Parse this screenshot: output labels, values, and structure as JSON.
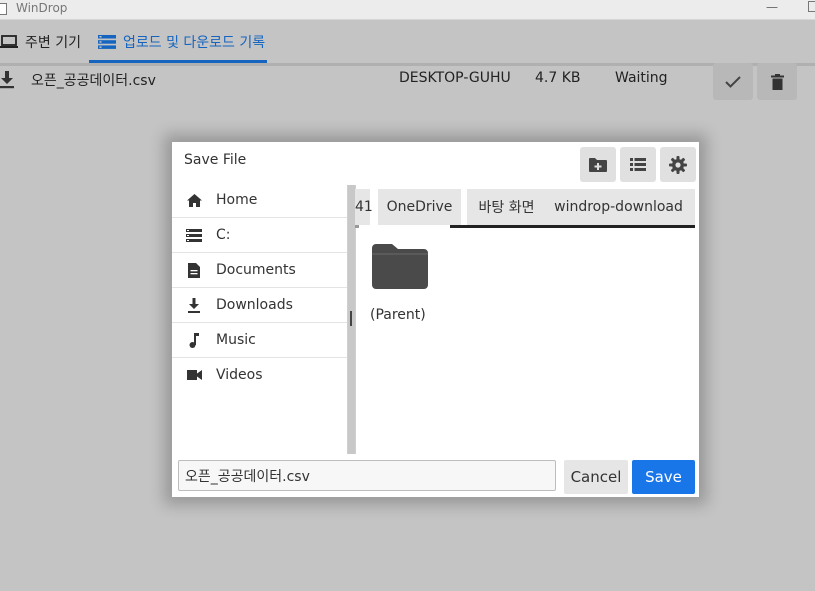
{
  "window": {
    "title": "WinDrop"
  },
  "tabs": [
    {
      "label": "주변 기기",
      "icon": "laptop-icon"
    },
    {
      "label": "업로드 및 다운로드 기록",
      "icon": "storage-list-icon"
    }
  ],
  "accent_color": "#1565c0",
  "transfer": {
    "filename": "오픈_공공데이터.csv",
    "device": "DESKTOP-GUHU",
    "size": "4.7 KB",
    "status": "Waiting"
  },
  "dialog": {
    "title": "Save File",
    "sidebar": [
      {
        "label": "Home",
        "icon": "home-icon"
      },
      {
        "label": "C:",
        "icon": "drive-icon"
      },
      {
        "label": "Documents",
        "icon": "document-icon"
      },
      {
        "label": "Downloads",
        "icon": "download-icon"
      },
      {
        "label": "Music",
        "icon": "music-icon"
      },
      {
        "label": "Videos",
        "icon": "video-icon"
      }
    ],
    "breadcrumbs": [
      "41",
      "OneDrive",
      "바탕 화면",
      "windrop-download"
    ],
    "folders": [
      {
        "label": "(Parent)"
      }
    ],
    "filename_value": "오픈_공공데이터.csv",
    "cancel_label": "Cancel",
    "save_label": "Save",
    "save_color": "#1976e8"
  }
}
